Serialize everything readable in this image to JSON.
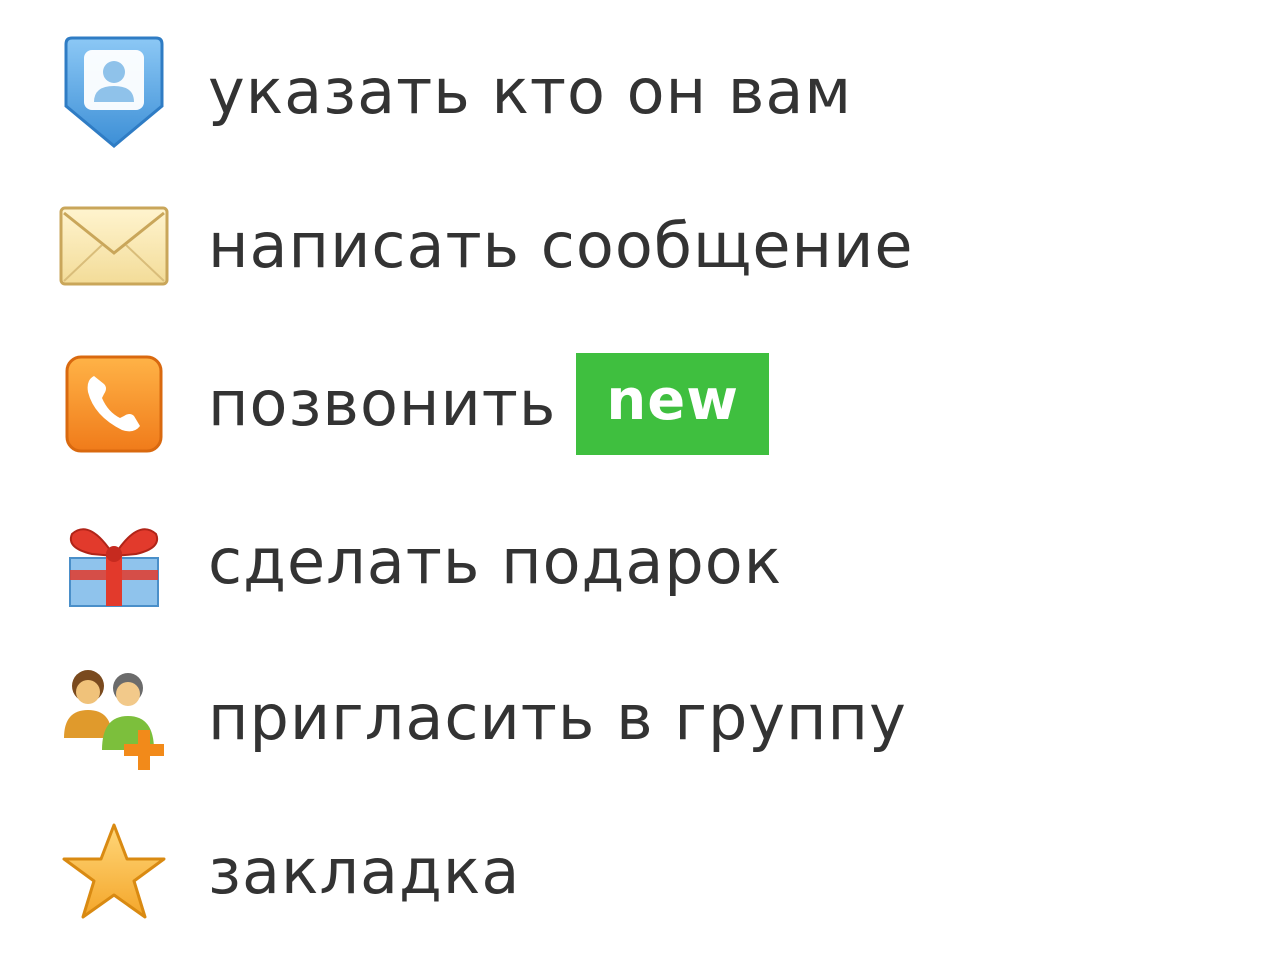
{
  "menu": {
    "items": [
      {
        "label": "указать кто он вам",
        "icon": "user-tag-icon"
      },
      {
        "label": "написать сообщение",
        "icon": "envelope-icon"
      },
      {
        "label": "позвонить",
        "icon": "phone-icon",
        "badge": "new"
      },
      {
        "label": "сделать подарок",
        "icon": "gift-icon"
      },
      {
        "label": "пригласить в группу",
        "icon": "group-add-icon"
      },
      {
        "label": "закладка",
        "icon": "star-icon"
      }
    ]
  },
  "colors": {
    "text": "#333333",
    "badge": "#3fbf3f",
    "badge_text": "#ffffff"
  }
}
